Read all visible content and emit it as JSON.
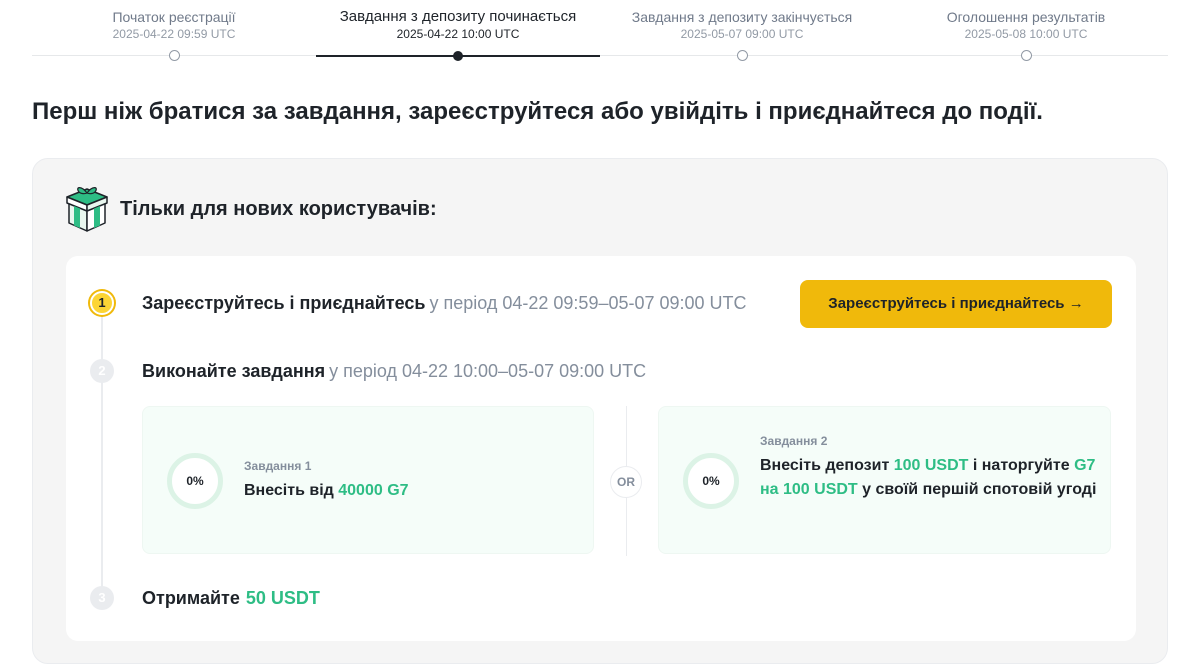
{
  "timeline": {
    "stages": [
      {
        "title": "Початок реєстрації",
        "date": "2025-04-22 09:59 UTC",
        "active": false
      },
      {
        "title": "Завдання з депозиту починається",
        "date": "2025-04-22 10:00 UTC",
        "active": true
      },
      {
        "title": "Завдання з депозиту закінчується",
        "date": "2025-05-07 09:00 UTC",
        "active": false
      },
      {
        "title": "Оголошення результатів",
        "date": "2025-05-08 10:00 UTC",
        "active": false
      }
    ]
  },
  "heading": "Перш ніж братися за завдання, зареєструйтеся або увійдіть і приєднайтеся до події.",
  "section": {
    "icon": "gift-box-icon",
    "title": "Тільки для нових користувачів:"
  },
  "steps": [
    {
      "number": "1",
      "title": "Зареєструйтесь і приєднайтесь",
      "period": "у період 04-22 09:59–05-07 09:00 UTC"
    },
    {
      "number": "2",
      "title": "Виконайте завдання",
      "period": "у період 04-22 10:00–05-07 09:00 UTC"
    },
    {
      "number": "3",
      "title": "Отримайте",
      "reward": "50 USDT"
    }
  ],
  "register_button": {
    "label": "Зареєструйтесь і приєднайтесь →"
  },
  "tasks": [
    {
      "label": "Завдання 1",
      "progress": "0%",
      "text_parts": [
        "Внесіть від ",
        "40000 G7"
      ]
    },
    {
      "label": "Завдання 2",
      "progress": "0%",
      "text_parts": [
        "Внесіть депозит ",
        "100 USDT",
        " і наторгуйте ",
        "G7 на 100 USDT",
        " у своїй першій спотовій угоді"
      ]
    }
  ],
  "or_label": "OR",
  "colors": {
    "accent": "#f0b90b",
    "green": "#2ebd85",
    "text": "#1e2329",
    "muted": "#848e9c"
  }
}
